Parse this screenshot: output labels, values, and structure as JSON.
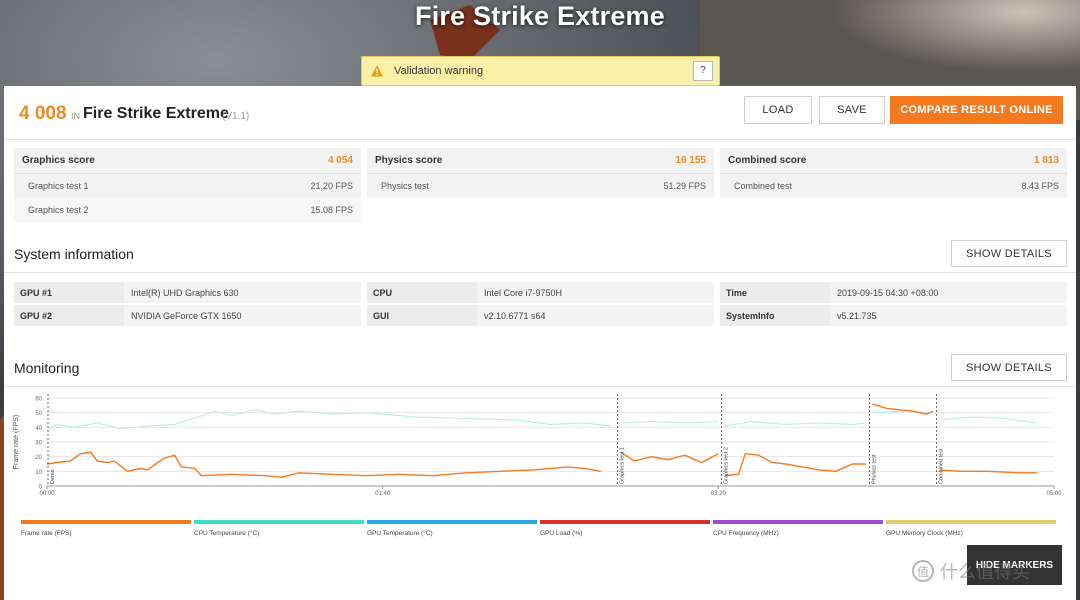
{
  "app": {
    "title": "Fire Strike Extreme"
  },
  "warning": {
    "text": "Validation warning",
    "help": "?"
  },
  "result": {
    "score": "4 008",
    "in_label": "IN",
    "benchmark": "Fire Strike Extreme",
    "version": "(V1.1)"
  },
  "toolbar": {
    "load": "LOAD",
    "save": "SAVE",
    "compare": "COMPARE RESULT ONLINE"
  },
  "scores": [
    {
      "name": "Graphics score",
      "value": "4 054",
      "tests": [
        {
          "name": "Graphics test 1",
          "value": "21.20 FPS"
        },
        {
          "name": "Graphics test 2",
          "value": "15.08 FPS"
        }
      ]
    },
    {
      "name": "Physics score",
      "value": "16 155",
      "tests": [
        {
          "name": "Physics test",
          "value": "51.29 FPS"
        }
      ]
    },
    {
      "name": "Combined score",
      "value": "1 813",
      "tests": [
        {
          "name": "Combined test",
          "value": "8.43 FPS"
        }
      ]
    }
  ],
  "system_info": {
    "title": "System information",
    "show_details": "SHOW DETAILS",
    "columns": [
      [
        {
          "key": "GPU #1",
          "value": "Intel(R) UHD Graphics 630"
        },
        {
          "key": "GPU #2",
          "value": "NVIDIA GeForce GTX 1650"
        }
      ],
      [
        {
          "key": "CPU",
          "value": "Intel Core i7-9750H"
        },
        {
          "key": "GUI",
          "value": "v2.10.6771 s64"
        }
      ],
      [
        {
          "key": "Time",
          "value": "2019-09-15 04:30 +08:00"
        },
        {
          "key": "SystemInfo",
          "value": "v5.21.735"
        }
      ]
    ]
  },
  "monitoring": {
    "title": "Monitoring",
    "show_details": "SHOW DETAILS",
    "hide_markers": "HIDE MARKERS",
    "legend": [
      {
        "label": "Frame rate (FPS)",
        "color": "#f47a20"
      },
      {
        "label": "CPU Temperature (°C)",
        "color": "#3be0c0"
      },
      {
        "label": "GPU Temperature (°C)",
        "color": "#2aa8e0"
      },
      {
        "label": "GPU Load (%)",
        "color": "#d63030"
      },
      {
        "label": "CPU Frequency (MHz)",
        "color": "#9b4fd0"
      },
      {
        "label": "GPU Memory Clock (MHz)",
        "color": "#e8c870"
      }
    ]
  },
  "chart_data": {
    "type": "line",
    "ylabel": "Frame rate (FPS)",
    "yticks": [
      0,
      10,
      20,
      30,
      40,
      50,
      60
    ],
    "ylim": [
      0,
      60
    ],
    "xlim": [
      0,
      300
    ],
    "xticks": [
      {
        "t": 0,
        "label": "00:00"
      },
      {
        "t": 100,
        "label": "01:40"
      },
      {
        "t": 200,
        "label": "03:20"
      },
      {
        "t": 300,
        "label": "05:00"
      }
    ],
    "markers": [
      {
        "t": 0,
        "label": "Demo"
      },
      {
        "t": 170,
        "label": "Graphics test 1"
      },
      {
        "t": 201,
        "label": "Graphics test 2"
      },
      {
        "t": 245,
        "label": "Physics test"
      },
      {
        "t": 265,
        "label": "Combined test"
      }
    ],
    "series": [
      {
        "name": "Frame rate (FPS)",
        "color": "#f47a20",
        "segments": [
          [
            [
              0,
              15
            ],
            [
              3,
              16
            ],
            [
              7,
              17
            ],
            [
              10,
              22
            ],
            [
              13,
              23
            ],
            [
              15,
              17
            ],
            [
              18,
              16
            ],
            [
              20,
              17
            ],
            [
              24,
              10
            ],
            [
              28,
              12
            ],
            [
              30,
              11
            ],
            [
              33,
              16
            ],
            [
              35,
              19
            ],
            [
              38,
              21
            ],
            [
              40,
              13
            ],
            [
              44,
              12
            ],
            [
              46,
              7
            ],
            [
              55,
              8
            ],
            [
              65,
              7
            ],
            [
              70,
              6
            ],
            [
              75,
              9
            ],
            [
              85,
              8
            ],
            [
              95,
              7
            ],
            [
              105,
              8
            ],
            [
              115,
              7
            ],
            [
              125,
              9
            ],
            [
              135,
              10
            ],
            [
              145,
              11
            ],
            [
              155,
              13
            ],
            [
              160,
              12
            ],
            [
              165,
              10
            ]
          ],
          [
            [
              171,
              23
            ],
            [
              175,
              17
            ],
            [
              180,
              20
            ],
            [
              185,
              18
            ],
            [
              190,
              21
            ],
            [
              195,
              16
            ],
            [
              200,
              22
            ]
          ],
          [
            [
              202,
              7
            ],
            [
              206,
              8
            ],
            [
              208,
              22
            ],
            [
              212,
              21
            ],
            [
              216,
              16
            ],
            [
              220,
              15
            ],
            [
              225,
              13
            ],
            [
              230,
              11
            ],
            [
              235,
              10
            ],
            [
              240,
              15
            ],
            [
              244,
              15
            ]
          ],
          [
            [
              246,
              56
            ],
            [
              250,
              53
            ],
            [
              254,
              52
            ],
            [
              258,
              51
            ],
            [
              262,
              49
            ],
            [
              264,
              51
            ]
          ],
          [
            [
              266,
              11
            ],
            [
              272,
              10
            ],
            [
              280,
              10
            ],
            [
              290,
              9
            ],
            [
              295,
              9
            ]
          ]
        ]
      },
      {
        "name": "CPU Temperature (°C)",
        "color": "#b8ece6",
        "segments": [
          [
            [
              0,
              38
            ],
            [
              3,
              42
            ],
            [
              8,
              40
            ],
            [
              15,
              43
            ],
            [
              22,
              39
            ],
            [
              30,
              41
            ],
            [
              38,
              42
            ],
            [
              45,
              47
            ],
            [
              50,
              51
            ],
            [
              55,
              48
            ],
            [
              62,
              52
            ],
            [
              68,
              49
            ],
            [
              75,
              51
            ],
            [
              85,
              49
            ],
            [
              95,
              50
            ],
            [
              110,
              47
            ],
            [
              125,
              46
            ],
            [
              140,
              45
            ],
            [
              150,
              42
            ],
            [
              160,
              43
            ],
            [
              168,
              41
            ]
          ],
          [
            [
              171,
              43
            ],
            [
              180,
              44
            ],
            [
              190,
              43
            ],
            [
              200,
              44
            ]
          ],
          [
            [
              202,
              41
            ],
            [
              210,
              44
            ],
            [
              220,
              42
            ],
            [
              230,
              43
            ],
            [
              240,
              42
            ],
            [
              244,
              43
            ]
          ],
          [
            [
              246,
              50
            ],
            [
              255,
              51
            ],
            [
              264,
              50
            ]
          ],
          [
            [
              266,
              45
            ],
            [
              275,
              47
            ],
            [
              285,
              46
            ],
            [
              295,
              43
            ]
          ]
        ]
      }
    ]
  }
}
